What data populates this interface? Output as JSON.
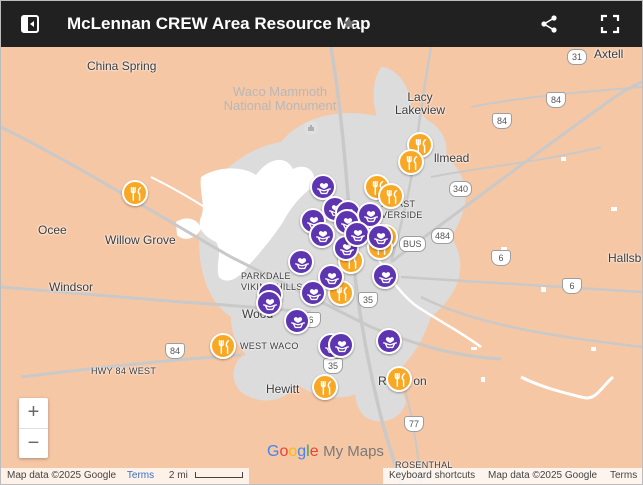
{
  "header": {
    "title": "McLennan CREW Area Resource Map",
    "background": "#212121"
  },
  "map": {
    "land_color": "#f6c7a5",
    "urban_color": "#dcdcdc",
    "water_color": "#ffffff",
    "labels": {
      "china_spring": "China Spring",
      "waco_mammoth": "Waco Mammoth\nNational Monument",
      "lacy_lakeview": "Lacy\nLakeview",
      "bellmead": "llmead",
      "axtell": "Axtell",
      "ocee": "Ocee",
      "willow_grove": "Willow Grove",
      "east_riverside": "N EAST\nVERSIDE",
      "hallsburg": "Hallsb",
      "windsor": "Windsor",
      "parkdale": "PARKDALE\nVIKING HILLS",
      "woodway": "Wood",
      "west_waco": "WEST WACO",
      "hwy84": "HWY 84 WEST",
      "hewitt": "Hewitt",
      "robinson": "Ro      on",
      "rosenthal": "ROSENTHAL"
    },
    "shields": {
      "s31": "31",
      "s84_ne": "84",
      "s84_e": "84",
      "s340": "340",
      "s484": "484",
      "sbus": "BUS",
      "s6_e": "6",
      "s6_far": "6",
      "s35_n": "35",
      "s35_s": "35",
      "s6_w": "6",
      "s84_w": "84",
      "s77": "77"
    },
    "zoom": {
      "in_label": "+",
      "out_label": "−"
    },
    "brand": {
      "g1": "G",
      "o1": "o",
      "o2": "o",
      "g2": "g",
      "l": "l",
      "e": "e",
      "rest": "My Maps"
    },
    "attribution_left": {
      "data": "Map data ©2025 Google",
      "terms": "Terms",
      "scale": "2 mi"
    },
    "attribution_right": {
      "keyboard": "Keyboard shortcuts",
      "data": "Map data ©2025 Google",
      "terms": "Terms"
    }
  },
  "legend_colors": {
    "purple_category": "#5e35b1",
    "orange_category": "#f9a825"
  },
  "markers": [
    {
      "icon": "food",
      "color": "#f9a825"
    },
    {
      "icon": "food",
      "color": "#f9a825"
    },
    {
      "icon": "food",
      "color": "#f9a825"
    },
    {
      "icon": "food",
      "color": "#f9a825"
    },
    {
      "icon": "food",
      "color": "#f9a825"
    },
    {
      "icon": "food",
      "color": "#f9a825"
    },
    {
      "icon": "food",
      "color": "#f9a825"
    },
    {
      "icon": "food",
      "color": "#f9a825"
    },
    {
      "icon": "food",
      "color": "#f9a825"
    },
    {
      "icon": "food",
      "color": "#f9a825"
    },
    {
      "icon": "food",
      "color": "#f9a825"
    },
    {
      "icon": "food",
      "color": "#f9a825"
    },
    {
      "icon": "care",
      "color": "#5e35b1"
    },
    {
      "icon": "care",
      "color": "#5e35b1"
    },
    {
      "icon": "care",
      "color": "#5e35b1"
    },
    {
      "icon": "care",
      "color": "#5e35b1"
    },
    {
      "icon": "care",
      "color": "#5e35b1"
    },
    {
      "icon": "care",
      "color": "#5e35b1"
    },
    {
      "icon": "care",
      "color": "#5e35b1"
    },
    {
      "icon": "care",
      "color": "#5e35b1"
    },
    {
      "icon": "care",
      "color": "#5e35b1"
    },
    {
      "icon": "care",
      "color": "#5e35b1"
    },
    {
      "icon": "care",
      "color": "#5e35b1"
    },
    {
      "icon": "care",
      "color": "#5e35b1"
    },
    {
      "icon": "care",
      "color": "#5e35b1"
    },
    {
      "icon": "care",
      "color": "#5e35b1"
    },
    {
      "icon": "care",
      "color": "#5e35b1"
    },
    {
      "icon": "care",
      "color": "#5e35b1"
    },
    {
      "icon": "care",
      "color": "#5e35b1"
    },
    {
      "icon": "care",
      "color": "#5e35b1"
    },
    {
      "icon": "care",
      "color": "#5e35b1"
    },
    {
      "icon": "care",
      "color": "#5e35b1"
    }
  ]
}
